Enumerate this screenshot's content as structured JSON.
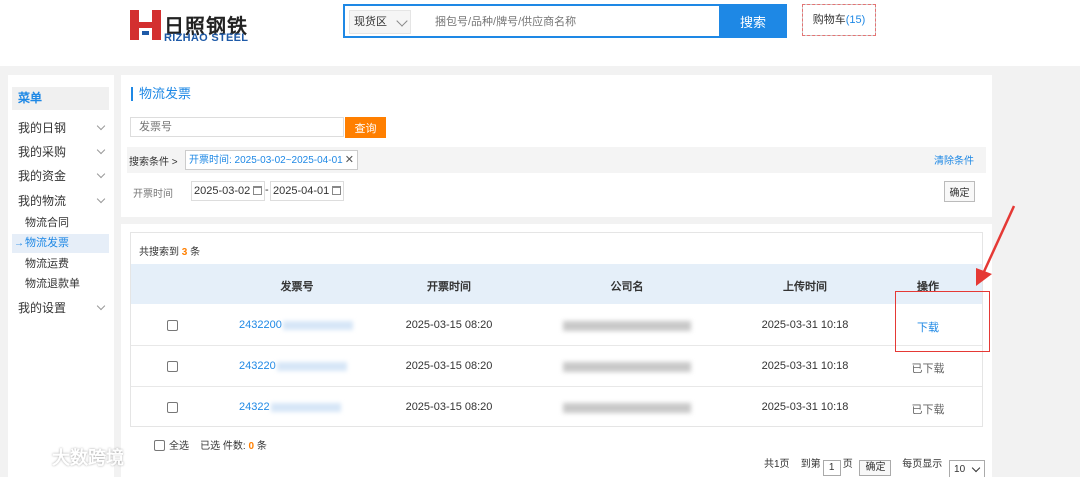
{
  "header": {
    "logo_cn": "日照钢铁",
    "logo_en": "RIZHAO STEEL",
    "search_zone": "现货区",
    "search_placeholder": "捆包号/品种/牌号/供应商名称",
    "search_button": "搜索",
    "cart_label": "购物车",
    "cart_count": "(15)"
  },
  "sidebar": {
    "title": "菜单",
    "items": [
      {
        "label": "我的日钢"
      },
      {
        "label": "我的采购"
      },
      {
        "label": "我的资金"
      },
      {
        "label": "我的物流"
      },
      {
        "label": "我的设置"
      }
    ],
    "sub_items": [
      {
        "label": "物流合同"
      },
      {
        "label": "物流发票"
      },
      {
        "label": "物流运费"
      },
      {
        "label": "物流退款单"
      }
    ]
  },
  "main": {
    "title": "物流发票",
    "invoice_placeholder": "发票号",
    "query_button": "查询",
    "cond_label": "搜索条件 >",
    "cond_tag": "开票时间: 2025-03-02~2025-04-01",
    "clear_cond": "清除条件",
    "date_label": "开票时间",
    "date_from": "2025-03-02",
    "date_sep": "-",
    "date_to": "2025-04-01",
    "ok_button": "确定"
  },
  "results": {
    "count_prefix": "共搜索到",
    "count": "3",
    "count_suffix": "条",
    "columns": [
      "发票号",
      "开票时间",
      "公司名",
      "上传时间",
      "操作"
    ],
    "rows": [
      {
        "invoice": "2432200",
        "issue_time": "2025-03-15 08:20",
        "upload_time": "2025-03-31 10:18",
        "action": "下载"
      },
      {
        "invoice": "243220",
        "issue_time": "2025-03-15 08:20",
        "upload_time": "2025-03-31 10:18",
        "action": "已下载"
      },
      {
        "invoice": "24322",
        "issue_time": "2025-03-15 08:20",
        "upload_time": "2025-03-31 10:18",
        "action": "已下载"
      }
    ],
    "select_all": "全选",
    "selected_label": "已选 件数:",
    "selected_count": "0",
    "selected_suffix": "条",
    "pager": {
      "total_pages": "共1页",
      "goto_label": "到第",
      "page_input": "1",
      "page_suffix": "页",
      "go_button": "确定",
      "per_page_label": "每页显示",
      "per_page": "10"
    }
  },
  "watermark": "大数跨境",
  "colors": {
    "accent": "#1e88e5",
    "orange": "#ff7f00",
    "annotation": "#e53935"
  }
}
